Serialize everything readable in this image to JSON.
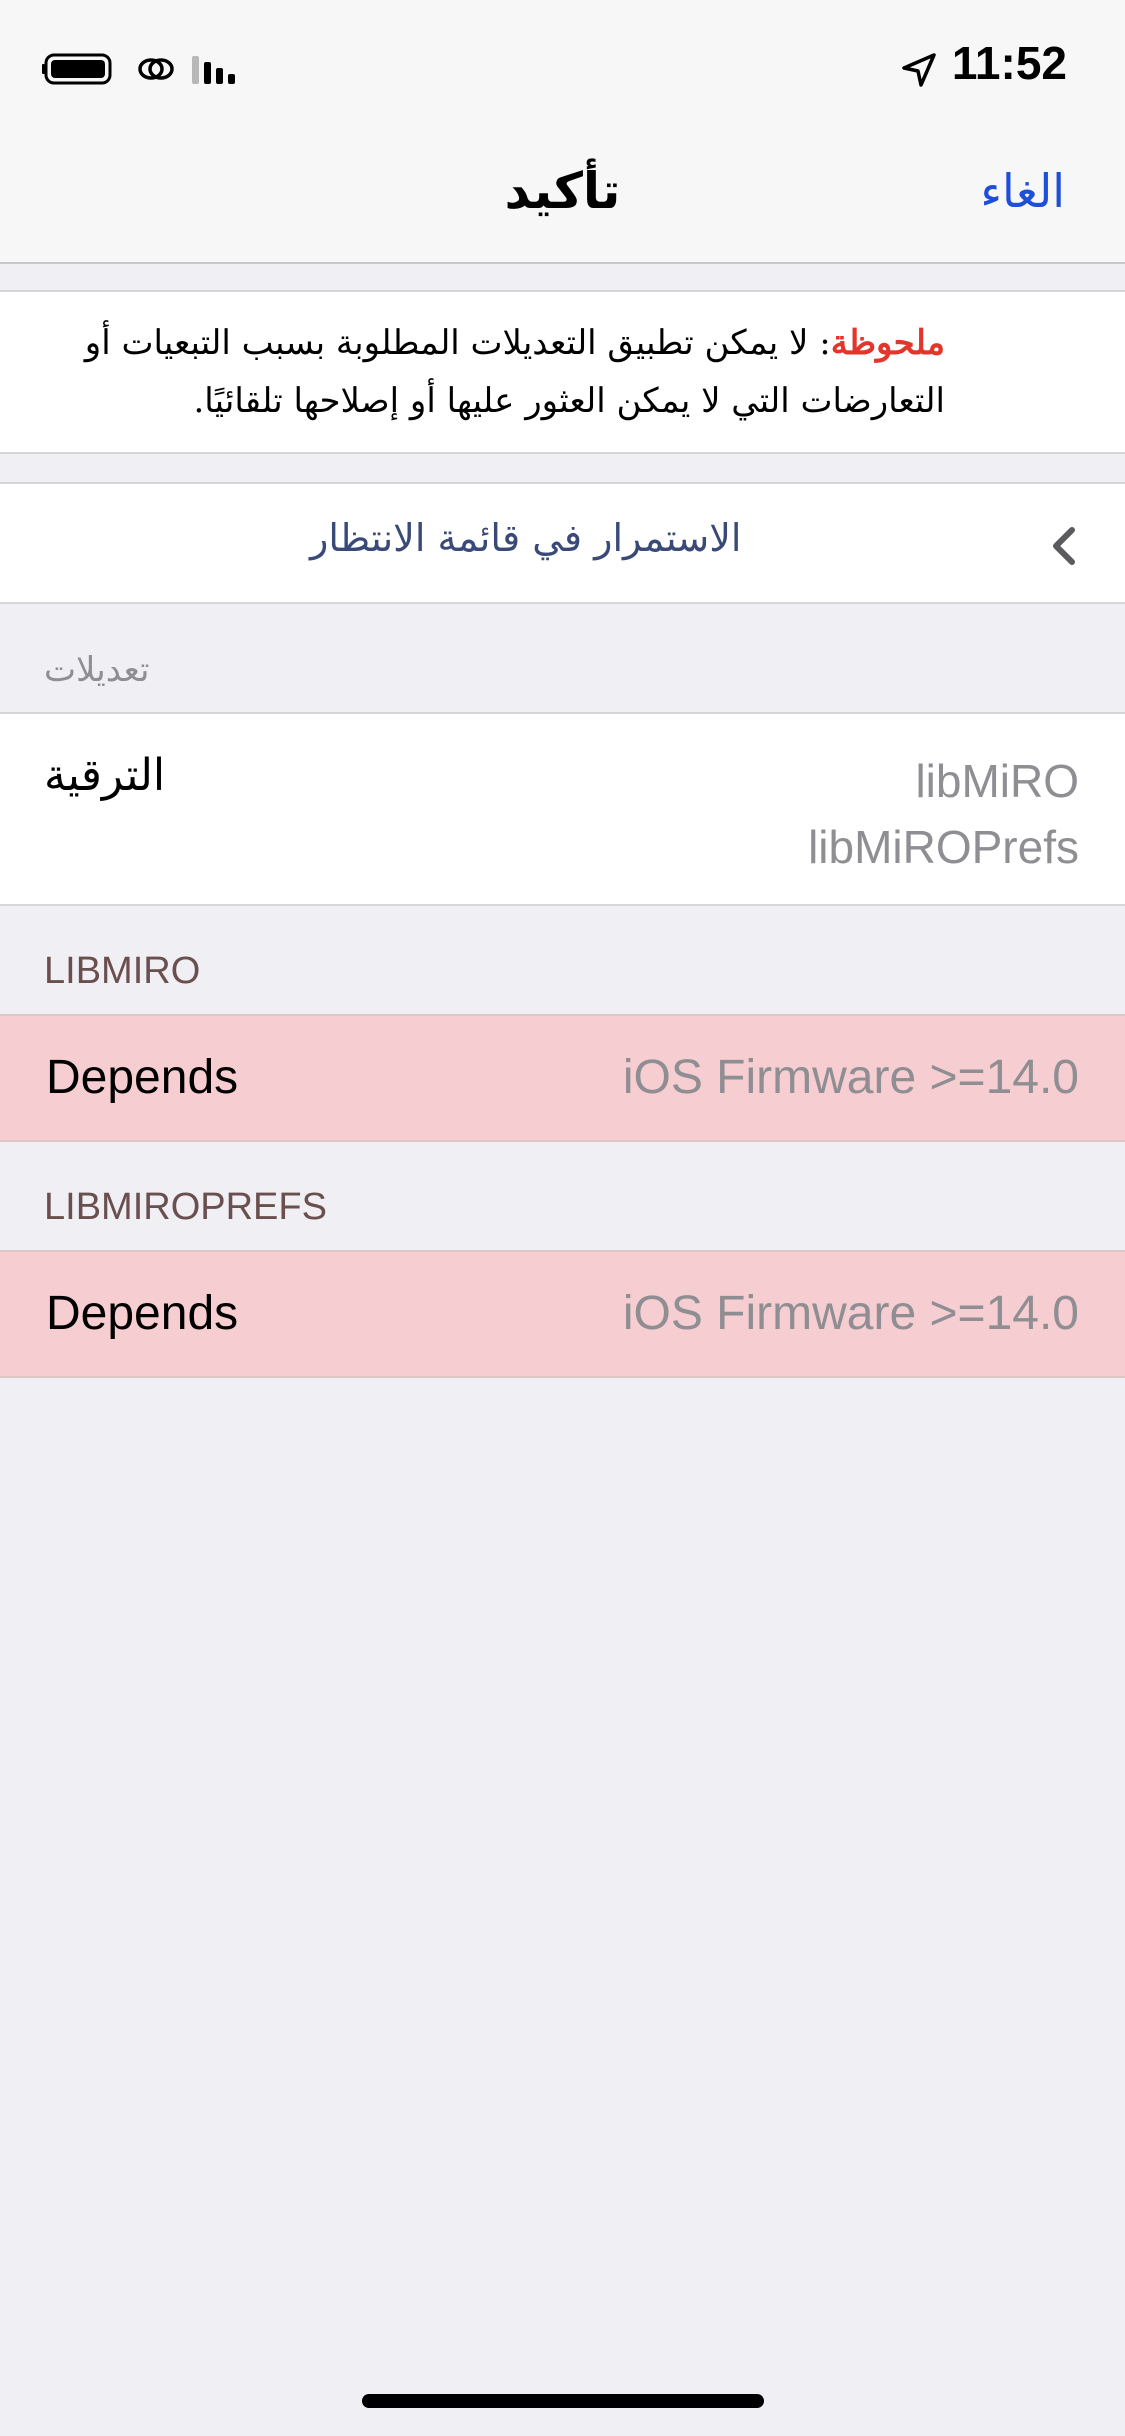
{
  "status_bar": {
    "time": "11:52",
    "icons": [
      "battery-icon",
      "link-icon",
      "signal-icon",
      "location-icon"
    ]
  },
  "nav": {
    "title": "تأكيد",
    "cancel": "الغاء"
  },
  "note": {
    "label": "ملحوظة",
    "text": ": لا يمكن تطبيق التعديلات المطلوبة بسبب التبعيات أو التعارضات التي لا يمكن العثور عليها أو إصلاحها تلقائيًا."
  },
  "queue": {
    "label": "الاستمرار في قائمة الانتظار"
  },
  "modifications": {
    "header": "تعديلات",
    "label": "الترقية",
    "packages": [
      "libMiRO",
      "libMiROPrefs"
    ]
  },
  "sections": [
    {
      "header": "LIBMIRO",
      "key": "Depends",
      "value": "iOS Firmware >=14.0"
    },
    {
      "header": "LIBMIROPREFS",
      "key": "Depends",
      "value": "iOS Firmware >=14.0"
    }
  ],
  "colors": {
    "accent": "#1d4fd8",
    "note_label": "#e3352b",
    "error_row": "#f6cdd0",
    "background": "#efeff4"
  }
}
